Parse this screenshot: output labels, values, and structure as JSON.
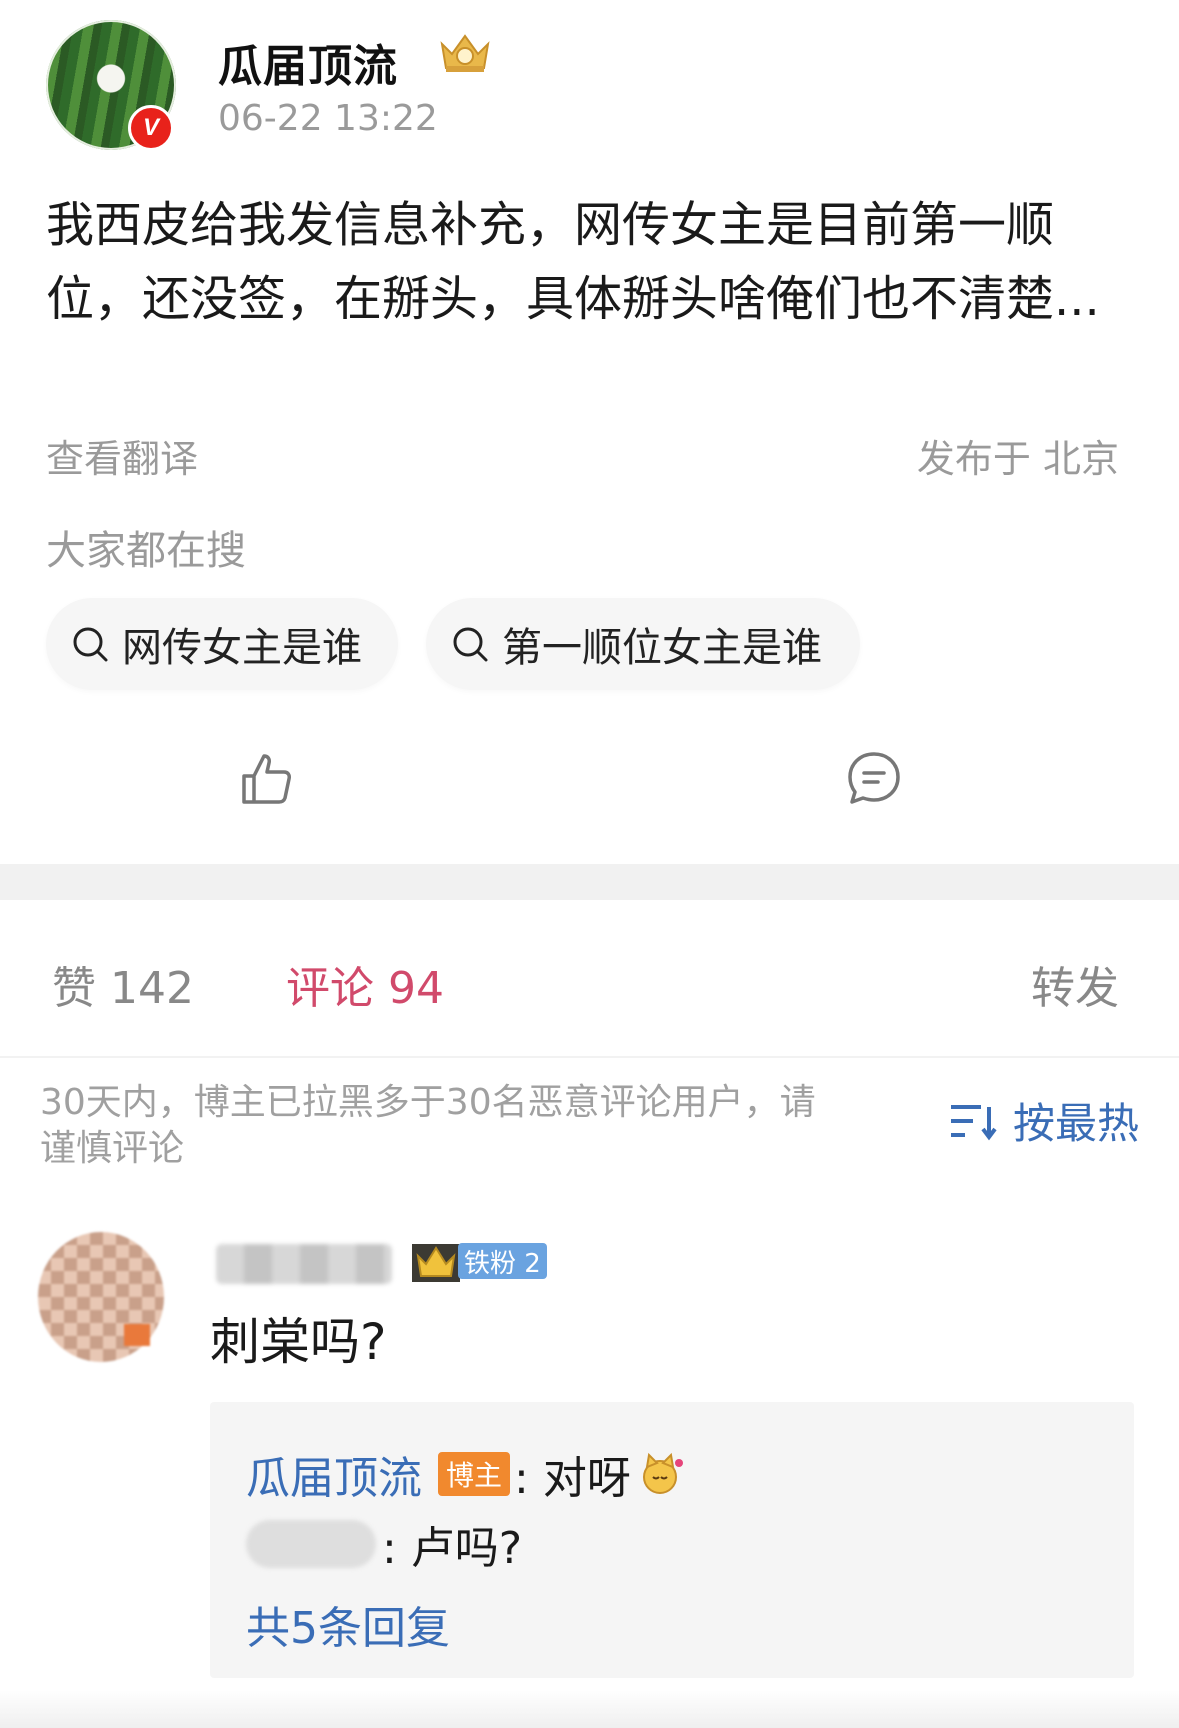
{
  "post": {
    "author": "瓜届顶流",
    "verified_badge": "V",
    "time": "06-22 13:22",
    "content": "我西皮给我发信息补充，网传女主是目前第一顺位，还没签，在掰头，具体掰头啥俺们也不清楚...",
    "translate_label": "查看翻译",
    "location": "发布于 北京",
    "search_title": "大家都在搜",
    "search_pills": [
      "网传女主是谁",
      "第一顺位女主是谁"
    ]
  },
  "stats": {
    "likes": "赞 142",
    "comments": "评论 94",
    "forward": "转发"
  },
  "notice": "30天内，博主已拉黑多于30名恶意评论用户，请谨慎评论",
  "sort_label": "按最热",
  "comment": {
    "fan_badge": "铁粉 2",
    "text": "刺棠吗?",
    "replies": [
      {
        "name": "瓜届顶流",
        "tag": "博主",
        "text": ": 对呀"
      },
      {
        "name": "",
        "text": ": 卢吗?"
      }
    ],
    "more_replies": "共5条回复"
  },
  "colors": {
    "accent_blue": "#3a6db6",
    "comment_red": "#d14a6b",
    "badge_orange": "#f1892e"
  }
}
